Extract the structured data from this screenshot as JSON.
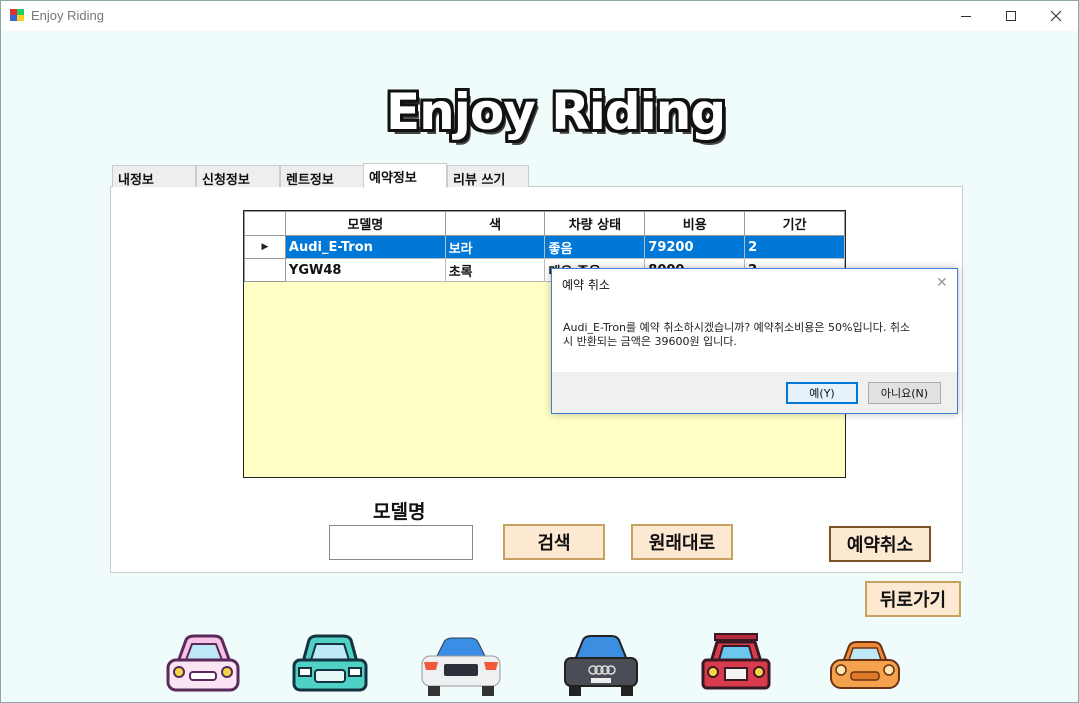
{
  "window": {
    "title": "Enjoy Riding"
  },
  "logo": {
    "text": "Enjoy Riding"
  },
  "tabs": [
    {
      "label": "내정보"
    },
    {
      "label": "신청정보"
    },
    {
      "label": "렌트정보"
    },
    {
      "label": "예약정보",
      "active": true
    },
    {
      "label": "리뷰 쓰기"
    }
  ],
  "table": {
    "headers": [
      "모델명",
      "색",
      "차량 상태",
      "비용",
      "기간"
    ],
    "rows": [
      {
        "cells": [
          "Audi_E-Tron",
          "보라",
          "좋음",
          "79200",
          "2"
        ],
        "selected": true
      },
      {
        "cells": [
          "YGW48",
          "초록",
          "매우 좋음",
          "8000",
          "2"
        ],
        "selected": false
      }
    ]
  },
  "search": {
    "label": "모델명",
    "value": ""
  },
  "buttons": {
    "search": "검색",
    "reset": "원래대로",
    "cancel_reservation": "예약취소",
    "back": "뒤로가기"
  },
  "dialog": {
    "title": "예약 취소",
    "message_line1": "Audi_E-Tron를 예약 취소하시겠습니까? 예약취소비용은 50%입니다. 취소",
    "message_line2": "시 반환되는 금액은 39600원 입니다.",
    "yes": "예(Y)",
    "no": "아니요(N)"
  },
  "colors": {
    "accent": "#0078d7",
    "button_bg": "#fde9d2",
    "grid_bg": "#ffffc6",
    "window_bg": "#f0fbfb"
  }
}
